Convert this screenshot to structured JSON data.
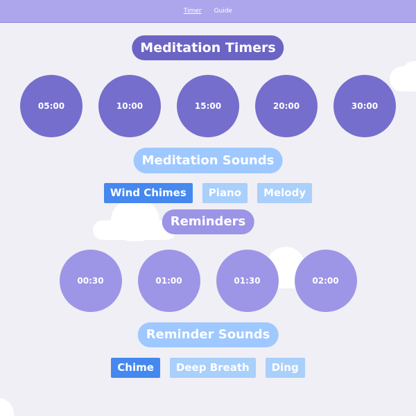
{
  "nav": {
    "links": [
      {
        "label": "Timer",
        "active": true
      },
      {
        "label": "Guide",
        "active": false
      }
    ]
  },
  "sections": {
    "meditation_timers": {
      "title": "Meditation Timers",
      "items": [
        "05:00",
        "10:00",
        "15:00",
        "20:00",
        "30:00"
      ]
    },
    "meditation_sounds": {
      "title": "Meditation Sounds",
      "items": [
        "Wind Chimes",
        "Piano",
        "Melody"
      ],
      "selected": "Wind Chimes"
    },
    "reminders": {
      "title": "Reminders",
      "items": [
        "00:30",
        "01:00",
        "01:30",
        "02:00"
      ]
    },
    "reminder_sounds": {
      "title": "Reminder Sounds",
      "items": [
        "Chime",
        "Deep Breath",
        "Ding"
      ],
      "selected": "Chime"
    }
  },
  "colors": {
    "background": "#f0eff5",
    "nav": "#ada6ec",
    "timer_circle": "#756ecc",
    "reminder_circle": "#9d95e6",
    "sound_selected": "#4488f0",
    "sound_unselected": "#a9cffb",
    "heading_light_blue": "#9ec8ff"
  }
}
